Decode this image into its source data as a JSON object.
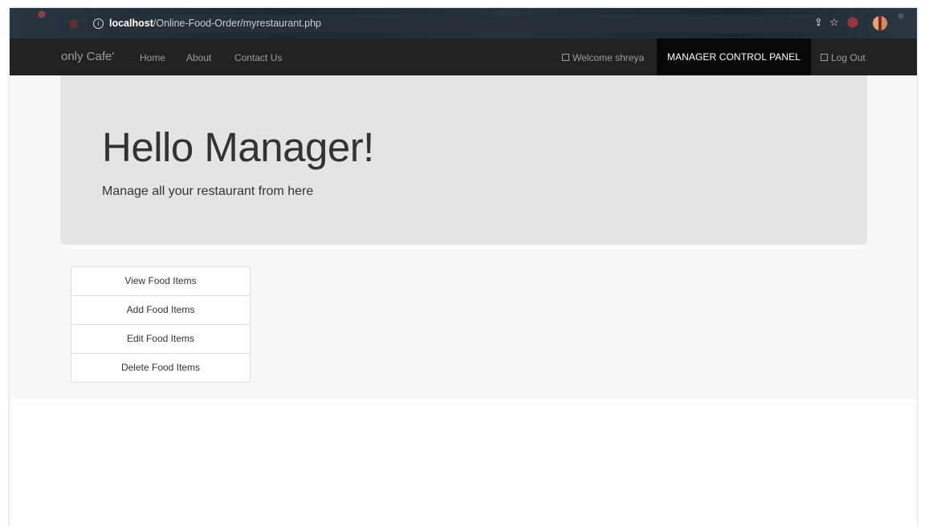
{
  "browser": {
    "url_host": "localhost",
    "url_path": "/Online-Food-Order/myrestaurant.php"
  },
  "navbar": {
    "brand": "only Cafe'",
    "links": [
      "Home",
      "About",
      "Contact Us"
    ],
    "welcome": "Welcome shreya",
    "manager_panel": "MANAGER CONTROL PANEL",
    "logout": "Log Out"
  },
  "hero": {
    "title": "Hello Manager!",
    "subtitle": "Manage all your restaurant from here"
  },
  "menu": {
    "items": [
      "View Food Items",
      "Add Food Items",
      "Edit Food Items",
      "Delete Food Items"
    ]
  },
  "colors": {
    "navbar_bg": "#222222",
    "active_nav_bg": "#080808",
    "jumbotron_bg": "#e4e4e4",
    "content_bg": "#f8f8f8"
  }
}
